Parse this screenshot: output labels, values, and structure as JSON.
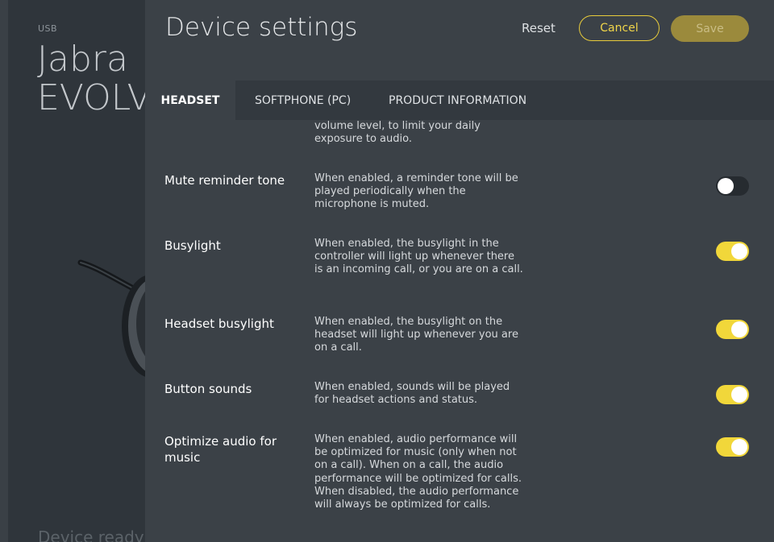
{
  "device": {
    "connection": "USB",
    "name_line1": "Jabra",
    "name_line2": "EVOLVE",
    "status": "Device ready"
  },
  "header": {
    "title": "Device settings",
    "reset_label": "Reset",
    "cancel_label": "Cancel",
    "save_label": "Save"
  },
  "tabs": [
    {
      "label": "HEADSET",
      "active": true
    },
    {
      "label": "SOFTPHONE (PC)",
      "active": false
    },
    {
      "label": "PRODUCT INFORMATION",
      "active": false
    }
  ],
  "partial_desc": "volume level, to limit your daily exposure to audio.",
  "settings": [
    {
      "name": "Mute reminder tone",
      "desc": "When enabled, a reminder tone will be played periodically when the microphone is muted.",
      "enabled": false
    },
    {
      "name": "Busylight",
      "desc": "When enabled, the busylight in the controller will light up whenever there is an incoming call, or you are on a call.",
      "enabled": true
    },
    {
      "name": "Headset busylight",
      "desc": "When enabled, the busylight on the headset will light up whenever you are on a call.",
      "enabled": true
    },
    {
      "name": "Button sounds",
      "desc": "When enabled, sounds will be played for headset actions and status.",
      "enabled": true
    },
    {
      "name": "Optimize audio for music",
      "desc": "When enabled, audio performance will be optimized for music (only when not on a call). When on a call, the audio performance will be optimized for calls. When disabled, the audio performance will always be optimized for calls.",
      "enabled": true
    }
  ],
  "colors": {
    "accent": "#f1d73a",
    "panel_bg": "#3b4147",
    "tab_bar_bg": "#33393f",
    "toggle_off": "#262b30"
  }
}
